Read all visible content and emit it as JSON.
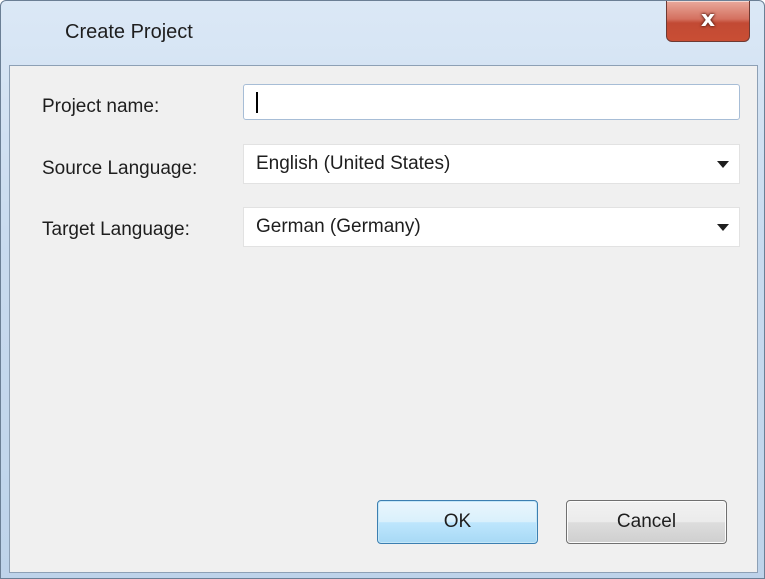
{
  "window": {
    "title": "Create Project",
    "close_label": "x"
  },
  "form": {
    "project_name": {
      "label": "Project name:",
      "value": ""
    },
    "source_language": {
      "label": "Source Language:",
      "value": "English (United States)"
    },
    "target_language": {
      "label": "Target Language:",
      "value": "German (Germany)"
    }
  },
  "buttons": {
    "ok_label": "OK",
    "cancel_label": "Cancel"
  },
  "icons": {
    "close": "close-icon",
    "dropdown": "chevron-down-icon"
  },
  "colors": {
    "titlebar": "#c9dbef",
    "close_button": "#c94e34",
    "client_background": "#f0f0f0",
    "default_button_border": "#3c7fb1"
  }
}
